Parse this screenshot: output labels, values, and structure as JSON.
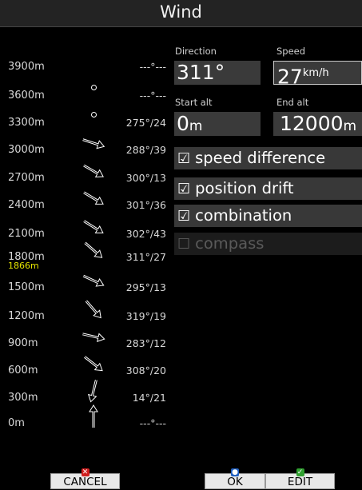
{
  "window": {
    "title": "Wind"
  },
  "profile": [
    {
      "altitude": "3900m",
      "direction": "---°---",
      "arrow": "none"
    },
    {
      "altitude": "3600m",
      "direction": "---°---",
      "arrow": "calm"
    },
    {
      "altitude": "3300m",
      "direction": "275°/24",
      "arrow": "calm"
    },
    {
      "altitude": "3000m",
      "direction": "288°/39",
      "arrow": "wind"
    },
    {
      "altitude": "2700m",
      "direction": "300°/13",
      "arrow": "wind"
    },
    {
      "altitude": "2400m",
      "direction": "301°/36",
      "arrow": "wind"
    },
    {
      "altitude": "2100m",
      "direction": "302°/43",
      "arrow": "wind"
    },
    {
      "altitude": "1800m",
      "direction": "311°/27",
      "arrow": "wind"
    },
    {
      "altitude": "1500m",
      "direction": "295°/13",
      "arrow": "wind"
    },
    {
      "altitude": "1200m",
      "direction": "319°/19",
      "arrow": "wind"
    },
    {
      "altitude": "900m",
      "direction": "283°/12",
      "arrow": "wind"
    },
    {
      "altitude": "600m",
      "direction": "308°/20",
      "arrow": "wind"
    },
    {
      "altitude": "300m",
      "direction": "14°/21",
      "arrow": "wind"
    },
    {
      "altitude": "0m",
      "direction": "---°---",
      "arrow": "wind"
    }
  ],
  "current_altitude": "1866m",
  "fields": {
    "direction": {
      "label": "Direction",
      "value": "311°"
    },
    "speed": {
      "label": "Speed",
      "value": "27",
      "unit": "km/h"
    },
    "start_alt": {
      "label": "Start alt",
      "value": "0",
      "unit": "m"
    },
    "end_alt": {
      "label": "End alt",
      "value": "12000",
      "unit": "m"
    }
  },
  "options": [
    {
      "label": "speed difference",
      "checked": true,
      "enabled": true
    },
    {
      "label": "position drift",
      "checked": true,
      "enabled": true
    },
    {
      "label": "combination",
      "checked": true,
      "enabled": true
    },
    {
      "label": "compass",
      "checked": false,
      "enabled": false
    }
  ],
  "buttons": {
    "cancel": "CANCEL",
    "ok": "OK",
    "edit": "EDIT"
  },
  "colors": {
    "background": "#000000",
    "field_bg": "#3a3a3a",
    "current_alt": "#e6e600",
    "cancel_icon": "#d02020",
    "ok_icon": "#2060c0",
    "edit_icon": "#30a030"
  }
}
